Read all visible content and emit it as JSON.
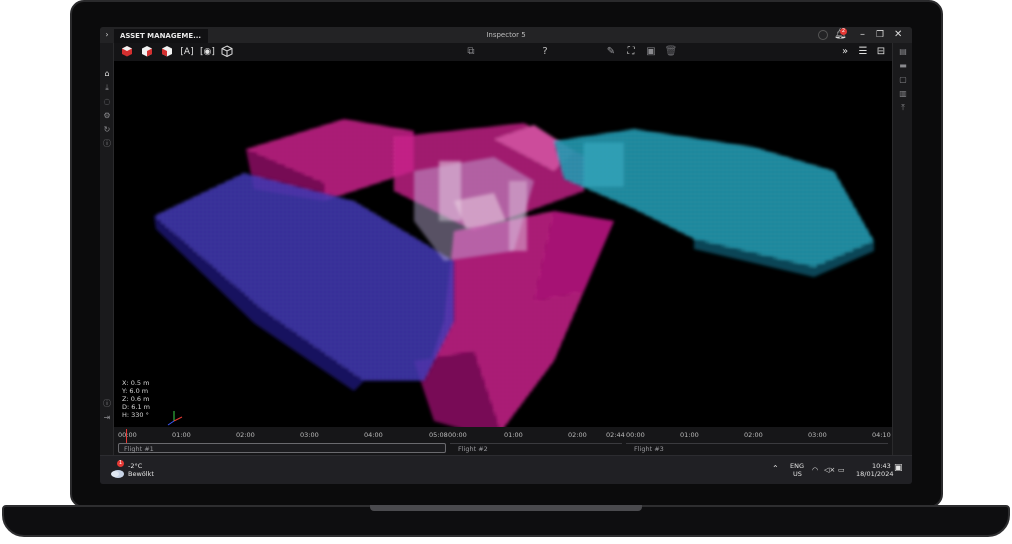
{
  "window": {
    "tab_label": "ASSET MANAGEME...",
    "title": "Inspector 5",
    "notification_count": "2"
  },
  "toolbar": {
    "left_tools": [
      "cube-red-icon",
      "cube-red-icon",
      "cube-red-icon",
      "cube-text-icon",
      "cube-focus-icon",
      "cube-outline-icon"
    ],
    "center_tools": [
      "compare-icon",
      "help-icon"
    ],
    "help_label": "?",
    "right_tools": [
      "pencil-icon",
      "crop-icon",
      "save-icon",
      "trash-icon"
    ],
    "far_right": [
      "chevrons-right-icon",
      "sliders-icon",
      "window-icon"
    ]
  },
  "viewport": {
    "coords": {
      "x": "X: 0.5 m",
      "y": "Y: 6.0 m",
      "z": "Z: 0.6 m",
      "d": "D: 6.1 m",
      "h": "H: 330 °"
    },
    "colors": {
      "magenta": "#e0188c",
      "blue": "#4b3fd6",
      "cyan": "#28c6e0",
      "white": "#e8e8ee"
    }
  },
  "timeline": {
    "flight1_ticks": [
      "00:00",
      "01:00",
      "02:00",
      "03:00",
      "04:00",
      "05:08"
    ],
    "flight2_ticks": [
      "00:00",
      "01:00",
      "02:00",
      "02:44"
    ],
    "flight3_ticks": [
      "00:00",
      "01:00",
      "02:00",
      "03:00",
      "04:10"
    ],
    "flights": [
      "Flight #1",
      "Flight #2",
      "Flight #3"
    ]
  },
  "taskbar": {
    "weather_temp": "-2°C",
    "weather_desc": "Bewölkt",
    "weather_badge": "1",
    "lang_top": "ENG",
    "lang_bottom": "US",
    "time": "10:43",
    "date": "18/01/2024"
  }
}
